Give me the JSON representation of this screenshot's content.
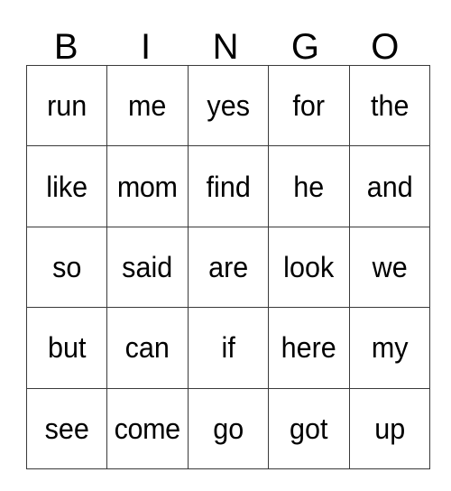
{
  "card": {
    "title": "BINGO",
    "columns": [
      "B",
      "I",
      "N",
      "G",
      "O"
    ],
    "text_color": "#000000",
    "border_color": "#3a3a3a",
    "background_color": "#ffffff",
    "rows": [
      {
        "cells": [
          "run",
          "me",
          "yes",
          "for",
          "the"
        ]
      },
      {
        "cells": [
          "like",
          "mom",
          "find",
          "he",
          "and"
        ]
      },
      {
        "cells": [
          "so",
          "said",
          "are",
          "look",
          "we"
        ]
      },
      {
        "cells": [
          "but",
          "can",
          "if",
          "here",
          "my"
        ]
      },
      {
        "cells": [
          "see",
          "come",
          "go",
          "got",
          "up"
        ]
      }
    ]
  }
}
